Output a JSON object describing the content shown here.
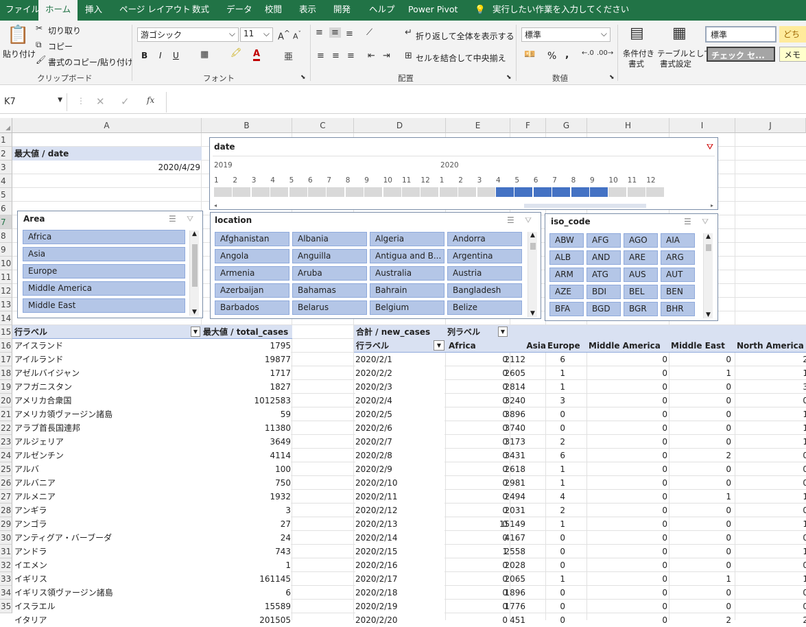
{
  "tabs": {
    "file": "ファイル",
    "home": "ホーム",
    "insert": "挿入",
    "page_layout": "ページ レイアウト",
    "formulas": "数式",
    "data": "データ",
    "review": "校閲",
    "view": "表示",
    "developer": "開発",
    "help": "ヘルプ",
    "power_pivot": "Power Pivot",
    "tell_me": "実行したい作業を入力してください"
  },
  "ribbon": {
    "paste": "貼り付け",
    "cut": "切り取り",
    "copy": "コピー",
    "format_painter": "書式のコピー/貼り付け",
    "clipboard": "クリップボード",
    "font_name": "游ゴシック",
    "font_size": "11",
    "bold": "B",
    "italic": "I",
    "underline": "U",
    "font": "フォント",
    "wrap_text": "折り返して全体を表示する",
    "merge_center": "セルを結合して中央揃え",
    "alignment": "配置",
    "number_format": "標準",
    "percent": "%",
    "comma": ",",
    "number": "数値",
    "conditional": [
      "条件付き",
      "書式"
    ],
    "table": [
      "テーブルとして",
      "書式設定"
    ],
    "style_normal": "標準",
    "style_bad": "どち",
    "style_check": "チェック セ...",
    "style_memo": "メモ"
  },
  "formula_bar": {
    "name_box": "K7",
    "fx": "fx",
    "formula": ""
  },
  "columns": [
    "A",
    "B",
    "C",
    "D",
    "E",
    "F",
    "G",
    "H",
    "I",
    "J"
  ],
  "rows": [
    "1",
    "2",
    "3",
    "4",
    "5",
    "6",
    "7",
    "8",
    "9",
    "10",
    "11",
    "12",
    "13",
    "14",
    "15",
    "16",
    "17",
    "18",
    "19",
    "20",
    "21",
    "22",
    "23",
    "24",
    "25",
    "26",
    "27",
    "28",
    "29",
    "30",
    "31",
    "32",
    "33",
    "34",
    "35"
  ],
  "cells": {
    "a2": "最大値 / date",
    "a3": "2020/4/29"
  },
  "date_slicer": {
    "title": "date",
    "year1": "2019",
    "year2": "2020",
    "months": [
      "1",
      "2",
      "3",
      "4",
      "5",
      "6",
      "7",
      "8",
      "9",
      "10",
      "11",
      "12",
      "1",
      "2",
      "3",
      "4",
      "5",
      "6",
      "7",
      "8",
      "9",
      "10",
      "11",
      "12"
    ],
    "selected": [
      15,
      16,
      17,
      18,
      19,
      20
    ]
  },
  "area_slicer": {
    "title": "Area",
    "items": [
      "Africa",
      "Asia",
      "Europe",
      "Middle America",
      "Middle East"
    ]
  },
  "location_slicer": {
    "title": "location",
    "items": [
      "Afghanistan",
      "Albania",
      "Algeria",
      "Andorra",
      "Angola",
      "Anguilla",
      "Antigua and B...",
      "Argentina",
      "Armenia",
      "Aruba",
      "Australia",
      "Austria",
      "Azerbaijan",
      "Bahamas",
      "Bahrain",
      "Bangladesh",
      "Barbados",
      "Belarus",
      "Belgium",
      "Belize"
    ]
  },
  "iso_slicer": {
    "title": "iso_code",
    "items": [
      "ABW",
      "AFG",
      "AGO",
      "AIA",
      "ALB",
      "AND",
      "ARE",
      "ARG",
      "ARM",
      "ATG",
      "AUS",
      "AUT",
      "AZE",
      "BDI",
      "BEL",
      "BEN",
      "BFA",
      "BGD",
      "BGR",
      "BHR"
    ]
  },
  "pivot1": {
    "row_label": "行ラベル",
    "value_header": "最大値 / total_cases",
    "rows": [
      [
        "アイスランド",
        "1795"
      ],
      [
        "アイルランド",
        "19877"
      ],
      [
        "アゼルバイジャン",
        "1717"
      ],
      [
        "アフガニスタン",
        "1827"
      ],
      [
        "アメリカ合衆国",
        "1012583"
      ],
      [
        "アメリカ領ヴァージン諸島",
        "59"
      ],
      [
        "アラブ首長国連邦",
        "11380"
      ],
      [
        "アルジェリア",
        "3649"
      ],
      [
        "アルゼンチン",
        "4114"
      ],
      [
        "アルバ",
        "100"
      ],
      [
        "アルバニア",
        "750"
      ],
      [
        "アルメニア",
        "1932"
      ],
      [
        "アンギラ",
        "3"
      ],
      [
        "アンゴラ",
        "27"
      ],
      [
        "アンティグア・バーブーダ",
        "24"
      ],
      [
        "アンドラ",
        "743"
      ],
      [
        "イエメン",
        "1"
      ],
      [
        "イギリス",
        "161145"
      ],
      [
        "イギリス領ヴァージン諸島",
        "6"
      ],
      [
        "イスラエル",
        "15589"
      ],
      [
        "イタリア",
        "201505"
      ]
    ]
  },
  "pivot2": {
    "value_header": "合計 / new_cases",
    "col_label": "列ラベル",
    "row_label": "行ラベル",
    "columns": [
      "Africa",
      "Asia",
      "Europe",
      "Middle America",
      "Middle East",
      "North America"
    ],
    "rows": [
      [
        "2020/2/1",
        "0",
        "2112",
        "6",
        "0",
        "0",
        "2"
      ],
      [
        "2020/2/2",
        "0",
        "2605",
        "1",
        "0",
        "1",
        "1"
      ],
      [
        "2020/2/3",
        "0",
        "2814",
        "1",
        "0",
        "0",
        "3"
      ],
      [
        "2020/2/4",
        "0",
        "3240",
        "3",
        "0",
        "0",
        "0"
      ],
      [
        "2020/2/5",
        "0",
        "3896",
        "0",
        "0",
        "0",
        "1"
      ],
      [
        "2020/2/6",
        "0",
        "3740",
        "0",
        "0",
        "0",
        "1"
      ],
      [
        "2020/2/7",
        "0",
        "3173",
        "2",
        "0",
        "0",
        "1"
      ],
      [
        "2020/2/8",
        "0",
        "3431",
        "6",
        "0",
        "2",
        "0"
      ],
      [
        "2020/2/9",
        "0",
        "2618",
        "1",
        "0",
        "0",
        "0"
      ],
      [
        "2020/2/10",
        "0",
        "2981",
        "1",
        "0",
        "0",
        "0"
      ],
      [
        "2020/2/11",
        "0",
        "2494",
        "4",
        "0",
        "1",
        "1"
      ],
      [
        "2020/2/12",
        "0",
        "2031",
        "2",
        "0",
        "0",
        "0"
      ],
      [
        "2020/2/13",
        "0",
        "15149",
        "1",
        "0",
        "0",
        "1"
      ],
      [
        "2020/2/14",
        "0",
        "4167",
        "0",
        "0",
        "0",
        "0"
      ],
      [
        "2020/2/15",
        "1",
        "2558",
        "0",
        "0",
        "0",
        "1"
      ],
      [
        "2020/2/16",
        "0",
        "2028",
        "0",
        "0",
        "0",
        "0"
      ],
      [
        "2020/2/17",
        "0",
        "2065",
        "1",
        "0",
        "1",
        "1"
      ],
      [
        "2020/2/18",
        "0",
        "1896",
        "0",
        "0",
        "0",
        "0"
      ],
      [
        "2020/2/19",
        "0",
        "1776",
        "0",
        "0",
        "0",
        "0"
      ],
      [
        "2020/2/20",
        "0",
        "451",
        "0",
        "0",
        "2",
        "2"
      ]
    ]
  }
}
